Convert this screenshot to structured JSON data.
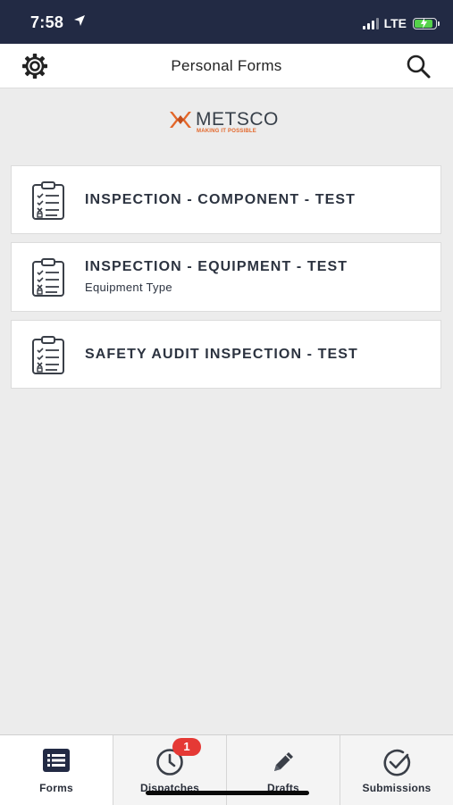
{
  "status_bar": {
    "time": "7:58",
    "network": "LTE",
    "battery_color": "#55d24a"
  },
  "header": {
    "title": "Personal Forms",
    "left_icon": "gear-icon",
    "right_icon": "search-icon"
  },
  "logo": {
    "name": "METSCO",
    "tagline": "MAKING IT POSSIBLE",
    "accent_color": "#e3672a"
  },
  "forms": [
    {
      "title": "INSPECTION - COMPONENT - TEST",
      "subtitle": "",
      "icon": "clipboard-checklist-icon"
    },
    {
      "title": "INSPECTION - EQUIPMENT - TEST",
      "subtitle": "Equipment Type",
      "icon": "clipboard-checklist-icon"
    },
    {
      "title": "SAFETY AUDIT INSPECTION - TEST",
      "subtitle": "",
      "icon": "clipboard-checklist-icon"
    }
  ],
  "tabs": [
    {
      "label": "Forms",
      "icon": "list-icon",
      "active": true
    },
    {
      "label": "Dispatches",
      "icon": "clock-icon",
      "badge": "1"
    },
    {
      "label": "Drafts",
      "icon": "pencil-icon"
    },
    {
      "label": "Submissions",
      "icon": "check-circle-icon"
    }
  ],
  "colors": {
    "status_bar_bg": "#222a44",
    "badge": "#e53935",
    "background": "#ececec"
  }
}
